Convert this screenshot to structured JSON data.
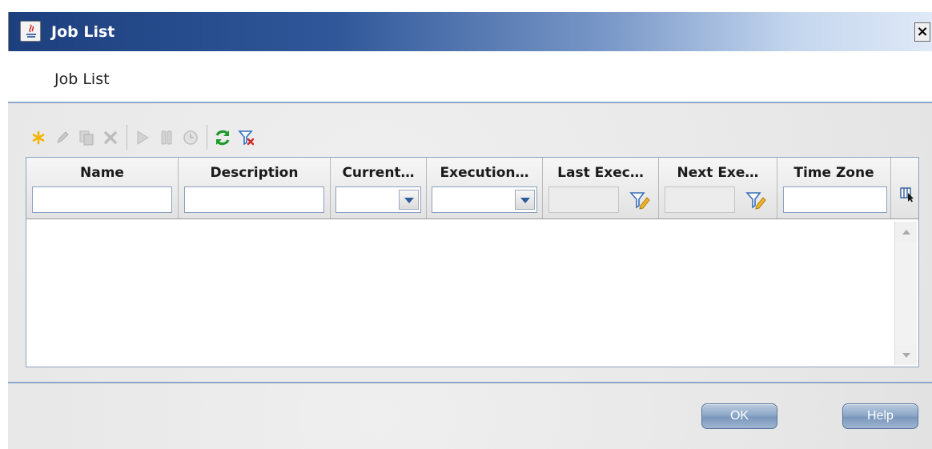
{
  "window": {
    "title": "Job List",
    "close_label": "×"
  },
  "header": {
    "title": "Job List"
  },
  "toolbar": {
    "buttons": [
      {
        "icon": "new-star-icon",
        "color": "#f2b400",
        "enabled": true
      },
      {
        "icon": "edit-pencil-icon",
        "enabled": false
      },
      {
        "icon": "copy-icon",
        "enabled": false
      },
      {
        "icon": "delete-x-icon",
        "enabled": false
      },
      {
        "icon": "run-play-icon",
        "enabled": false
      },
      {
        "icon": "pause-icon",
        "enabled": false
      },
      {
        "icon": "schedule-clock-icon",
        "enabled": false
      },
      {
        "icon": "refresh-icon",
        "color": "#1e9a2a",
        "enabled": true
      },
      {
        "icon": "clear-filter-icon",
        "color": "#2a6fc4",
        "enabled": true
      }
    ]
  },
  "grid": {
    "columns": [
      {
        "label": "Name",
        "filter": "text",
        "value": ""
      },
      {
        "label": "Description",
        "filter": "text",
        "value": ""
      },
      {
        "label": "Current…",
        "filter": "select",
        "value": ""
      },
      {
        "label": "Execution…",
        "filter": "select",
        "value": ""
      },
      {
        "label": "Last Exec…",
        "filter": "date",
        "value": ""
      },
      {
        "label": "Next Exe…",
        "filter": "date",
        "value": ""
      },
      {
        "label": "Time Zone",
        "filter": "text",
        "value": ""
      }
    ],
    "rows": []
  },
  "footer": {
    "ok_label": "OK",
    "help_label": "Help"
  },
  "colors": {
    "title_bar_start": "#1d3f7e",
    "separator": "#8ea8c8",
    "button_blue": "#8fa9c8"
  }
}
